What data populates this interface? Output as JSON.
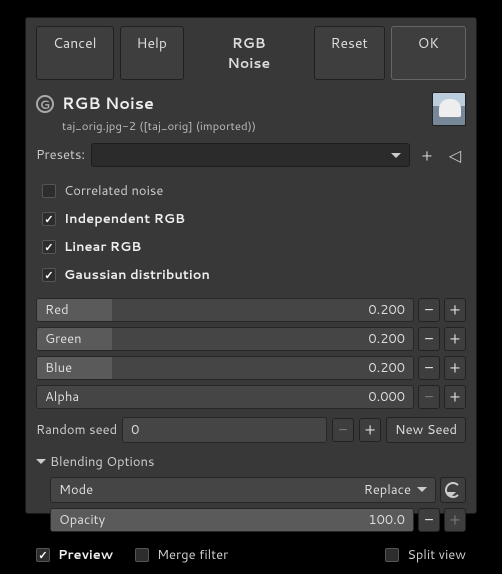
{
  "buttons": {
    "cancel": "Cancel",
    "help": "Help",
    "title": "RGB Noise",
    "reset": "Reset",
    "ok": "OK"
  },
  "header": {
    "title": "RGB Noise",
    "subtitle": "taj_orig.jpg-2 ([taj_orig] (imported))"
  },
  "presets_label": "Presets:",
  "checks": {
    "correlated": {
      "label": "Correlated noise",
      "on": false
    },
    "independent": {
      "label": "Independent RGB",
      "on": true
    },
    "linear": {
      "label": "Linear RGB",
      "on": true
    },
    "gaussian": {
      "label": "Gaussian distribution",
      "on": true
    }
  },
  "channels": {
    "red": {
      "label": "Red",
      "value": "0.200",
      "fill_pct": 20
    },
    "green": {
      "label": "Green",
      "value": "0.200",
      "fill_pct": 20
    },
    "blue": {
      "label": "Blue",
      "value": "0.200",
      "fill_pct": 20
    },
    "alpha": {
      "label": "Alpha",
      "value": "0.000",
      "fill_pct": 0
    }
  },
  "seed": {
    "label": "Random seed",
    "value": "0",
    "new_seed": "New Seed"
  },
  "blending": {
    "section": "Blending Options",
    "mode_label": "Mode",
    "mode_value": "Replace",
    "opacity_label": "Opacity",
    "opacity_value": "100.0"
  },
  "bottom": {
    "preview": "Preview",
    "merge": "Merge filter",
    "split": "Split view"
  }
}
